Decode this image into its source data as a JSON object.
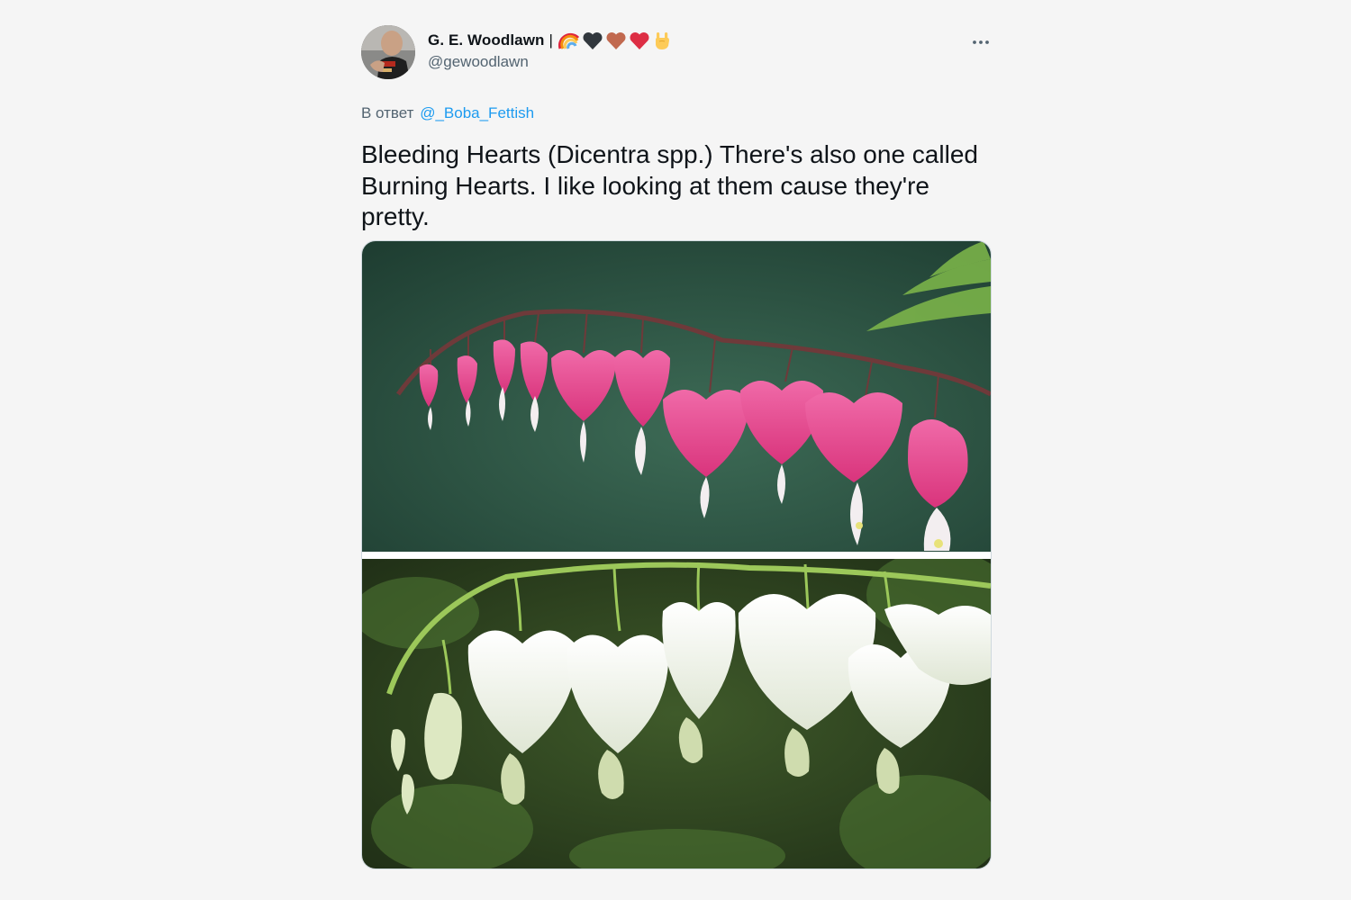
{
  "tweet": {
    "author": {
      "display_name": "G. E. Woodlawn",
      "name_separator": "|",
      "emojis": [
        "rainbow-icon",
        "black-heart-icon",
        "brown-heart-icon",
        "red-heart-icon",
        "rock-on-hand-icon"
      ],
      "handle": "@gewoodlawn",
      "avatar": "avatar-photo"
    },
    "more_icon": "more-horizontal-icon",
    "reply_to": {
      "prefix": "В ответ",
      "mention": "@_Boba_Fettish"
    },
    "text": "Bleeding Hearts (Dicentra spp.) There's also one called Burning Hearts. I like looking at them cause they're pretty.",
    "media": [
      {
        "name": "pink-bleeding-hearts-photo"
      },
      {
        "name": "white-bleeding-hearts-photo"
      }
    ]
  },
  "colors": {
    "background": "#f5f5f5",
    "text_primary": "#0f1419",
    "text_secondary": "#536471",
    "link": "#1d9bf0",
    "border": "#cfd9de"
  }
}
